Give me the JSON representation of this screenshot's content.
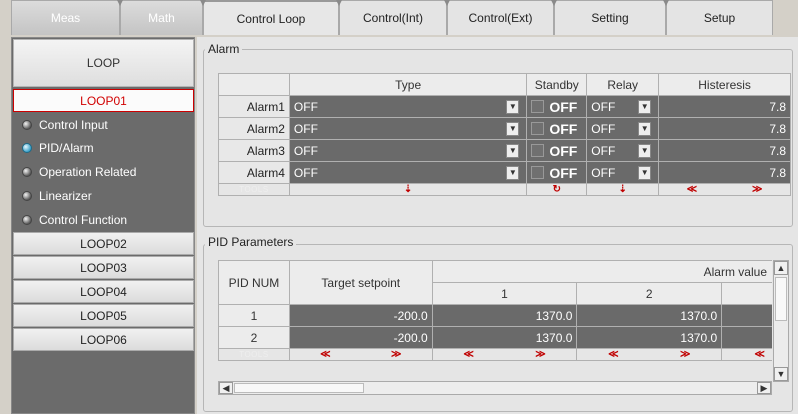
{
  "tabs": [
    {
      "label": "Meas"
    },
    {
      "label": "Math"
    },
    {
      "label": "Control Loop"
    },
    {
      "label": "Control(Int)"
    },
    {
      "label": "Control(Ext)"
    },
    {
      "label": "Setting"
    },
    {
      "label": "Setup"
    }
  ],
  "sidebar": {
    "header": "LOOP",
    "selected": "LOOP01",
    "items": [
      {
        "label": "Control Input",
        "active": false
      },
      {
        "label": "PID/Alarm",
        "active": true
      },
      {
        "label": "Operation Related",
        "active": false
      },
      {
        "label": "Linearizer",
        "active": false
      },
      {
        "label": "Control Function",
        "active": false
      }
    ],
    "loops": [
      "LOOP02",
      "LOOP03",
      "LOOP04",
      "LOOP05",
      "LOOP06"
    ]
  },
  "alarm": {
    "title": "Alarm",
    "headers": {
      "type": "Type",
      "standby": "Standby",
      "relay": "Relay",
      "histeresis": "Histeresis"
    },
    "rows": [
      {
        "name": "Alarm1",
        "type": "OFF",
        "standby": "OFF",
        "relay": "OFF",
        "histeresis": "7.8"
      },
      {
        "name": "Alarm2",
        "type": "OFF",
        "standby": "OFF",
        "relay": "OFF",
        "histeresis": "7.8"
      },
      {
        "name": "Alarm3",
        "type": "OFF",
        "standby": "OFF",
        "relay": "OFF",
        "histeresis": "7.8"
      },
      {
        "name": "Alarm4",
        "type": "OFF",
        "standby": "OFF",
        "relay": "OFF",
        "histeresis": "7.8"
      }
    ],
    "tools": "TOOLS"
  },
  "pid": {
    "title": "PID Parameters",
    "headers": {
      "pid_num": "PID NUM",
      "target": "Target setpoint",
      "alarm_value": "Alarm value",
      "col1": "1",
      "col2": "2"
    },
    "rows": [
      {
        "num": "1",
        "target": "-200.0",
        "a1": "1370.0",
        "a2": "1370.0"
      },
      {
        "num": "2",
        "target": "-200.0",
        "a1": "1370.0",
        "a2": "1370.0"
      }
    ],
    "tools": "TOOLS"
  },
  "icons": {
    "up_arrow": "▲",
    "down_arrow": "▼",
    "left_arrow": "◀",
    "right_arrow": "▶",
    "dd_arrow": "▼",
    "single_down": "⇣",
    "recycle": "↻",
    "double_left": "≪",
    "double_right": "≫"
  },
  "colors": {
    "selected_loop": "#d10000",
    "panel_dark": "#6a6a6a",
    "sidebar_bg": "#6b6b6b"
  }
}
